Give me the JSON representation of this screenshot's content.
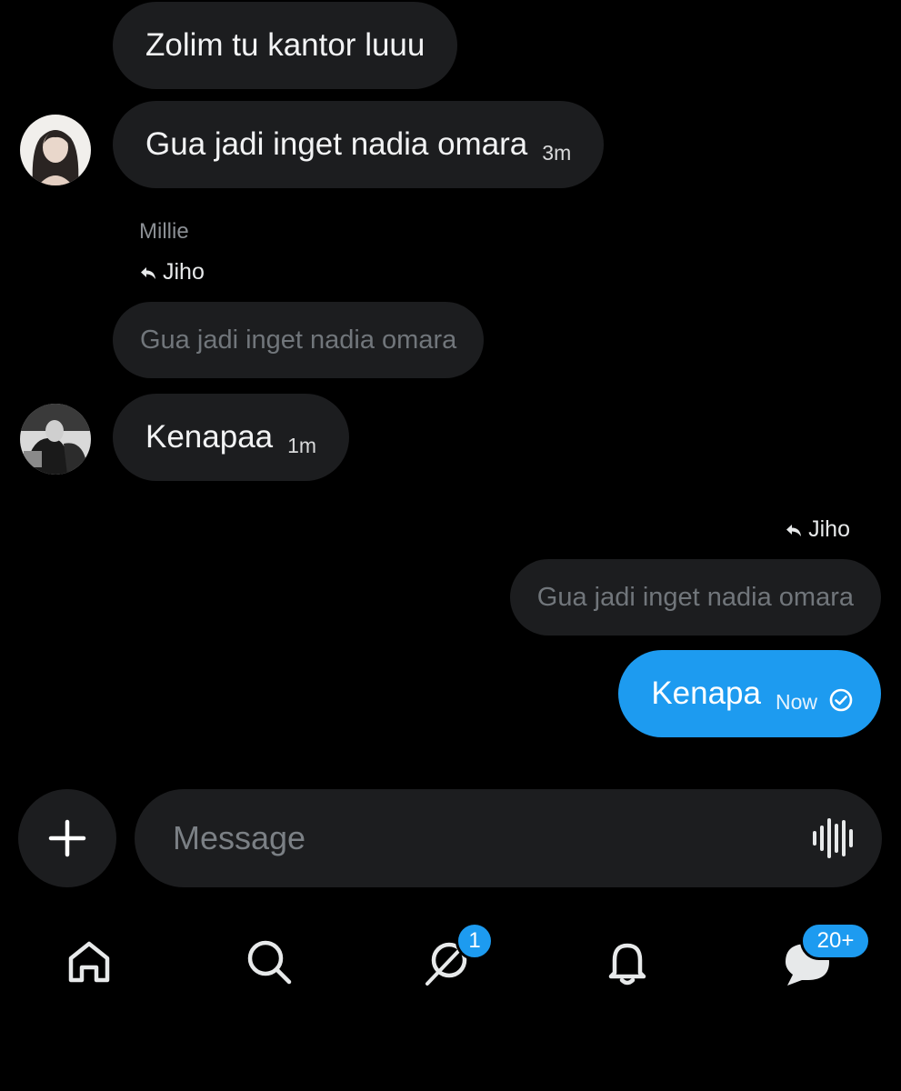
{
  "messages": [
    {
      "text": "Zolim tu kantor luuu"
    },
    {
      "text": "Gua jadi inget nadia omara",
      "time": "3m"
    },
    {
      "sender": "Millie",
      "reply_to": "Jiho",
      "quote": "Gua jadi inget nadia omara",
      "text": "Kenapaa",
      "time": "1m"
    },
    {
      "reply_to": "Jiho",
      "quote": "Gua jadi inget nadia omara",
      "text": "Kenapa",
      "time": "Now",
      "status_icon": "check-circle-icon"
    }
  ],
  "composer": {
    "placeholder": "Message",
    "add_icon": "plus-icon",
    "voice_icon": "waveform-icon"
  },
  "nav": {
    "items": [
      "home-icon",
      "search-icon",
      "grok-icon",
      "bell-icon",
      "messages-icon"
    ],
    "grok_badge": "1",
    "messages_badge": "20+"
  },
  "colors": {
    "accent": "#1d9bf0",
    "bubble": "#1c1d1f",
    "background": "#000000",
    "muted": "#71767b"
  }
}
